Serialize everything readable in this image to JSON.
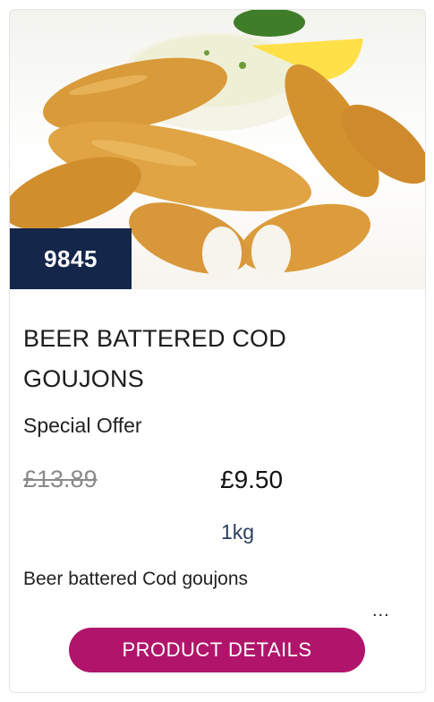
{
  "product": {
    "code": "9845",
    "title": "BEER BATTERED COD GOUJONS",
    "offer_label": "Special Offer",
    "old_price": "£13.89",
    "price": "£9.50",
    "weight": "1kg",
    "description": "Beer battered Cod goujons",
    "more_label": "...",
    "details_button": "PRODUCT DETAILS"
  },
  "colors": {
    "badge": "#14264a",
    "button": "#b0156b",
    "weight_text": "#2c3f5e"
  }
}
